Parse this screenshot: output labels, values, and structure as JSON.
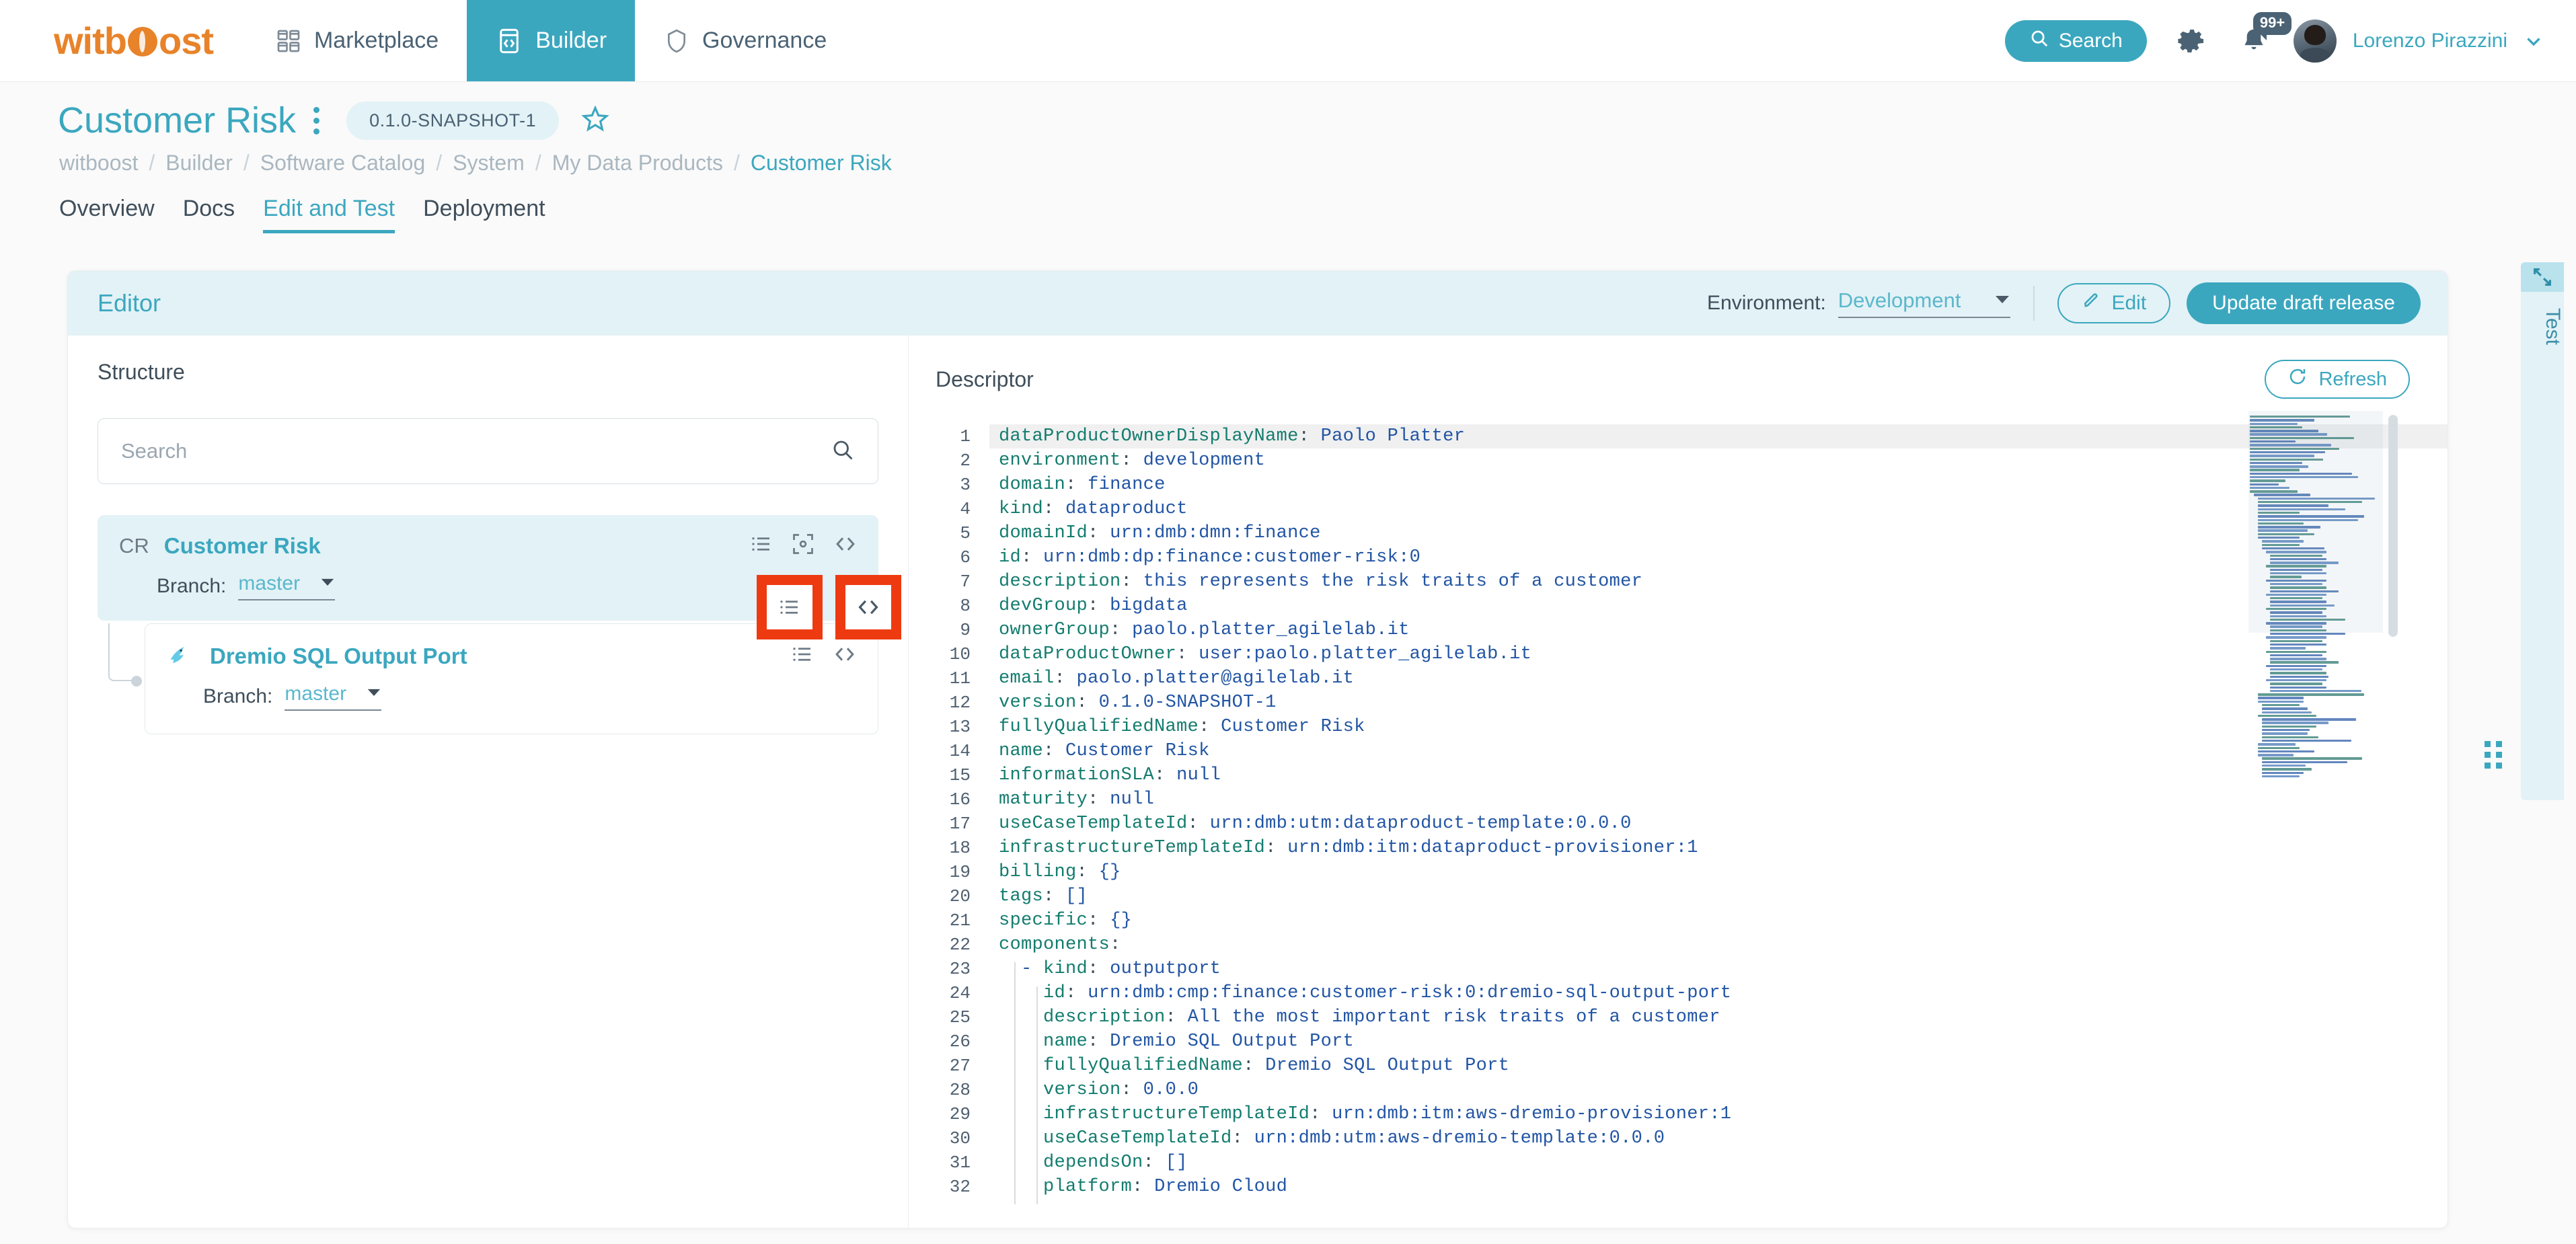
{
  "topnav": {
    "logo": "witboost",
    "items": [
      {
        "label": "Marketplace",
        "icon": "grid-icon",
        "active": false
      },
      {
        "label": "Builder",
        "icon": "code-window-icon",
        "active": true
      },
      {
        "label": "Governance",
        "icon": "shield-icon",
        "active": false
      }
    ],
    "search_label": "Search",
    "search_icon": "search-icon",
    "settings_icon": "gear-icon",
    "notifications_icon": "bell-icon",
    "notifications_badge": "99+",
    "user_name": "Lorenzo Pirazzini",
    "user_caret_icon": "chevron-down-icon",
    "avatar_icon": "avatar"
  },
  "page": {
    "title": "Customer Risk",
    "kebab_icon": "more-vertical-icon",
    "version_badge": "0.1.0-SNAPSHOT-1",
    "favorite_icon": "star-icon",
    "breadcrumb": [
      "witboost",
      "Builder",
      "Software Catalog",
      "System",
      "My Data Products",
      "Customer Risk"
    ],
    "tabs": [
      {
        "label": "Overview",
        "active": false
      },
      {
        "label": "Docs",
        "active": false
      },
      {
        "label": "Edit and Test",
        "active": true
      },
      {
        "label": "Deployment",
        "active": false
      }
    ]
  },
  "editor": {
    "title": "Editor",
    "environment_label": "Environment:",
    "environment_value": "Development",
    "environment_caret_icon": "caret-down-icon",
    "edit_button": "Edit",
    "edit_icon": "pencil-icon",
    "primary_button": "Update draft release"
  },
  "structure": {
    "title": "Structure",
    "search_placeholder": "Search",
    "search_value": "",
    "search_icon": "search-icon",
    "root": {
      "abbr": "CR",
      "name": "Customer Risk",
      "branch_label": "Branch:",
      "branch_value": "master",
      "actions": [
        "list-icon",
        "focus-target-icon",
        "code-brackets-icon"
      ]
    },
    "child": {
      "icon": "dremio-logo-icon",
      "name": "Dremio SQL Output Port",
      "branch_label": "Branch:",
      "branch_value": "master",
      "actions": [
        "list-icon",
        "code-brackets-icon"
      ],
      "highlighted_actions": [
        "list-icon",
        "code-brackets-icon"
      ]
    }
  },
  "descriptor": {
    "title": "Descriptor",
    "refresh_button": "Refresh",
    "refresh_icon": "refresh-icon",
    "lines": [
      {
        "n": 1,
        "indent": 0,
        "key": "dataProductOwnerDisplayName",
        "value": "Paolo Platter",
        "active": true
      },
      {
        "n": 2,
        "indent": 0,
        "key": "environment",
        "value": "development"
      },
      {
        "n": 3,
        "indent": 0,
        "key": "domain",
        "value": "finance"
      },
      {
        "n": 4,
        "indent": 0,
        "key": "kind",
        "value": "dataproduct"
      },
      {
        "n": 5,
        "indent": 0,
        "key": "domainId",
        "value": "urn:dmb:dmn:finance"
      },
      {
        "n": 6,
        "indent": 0,
        "key": "id",
        "value": "urn:dmb:dp:finance:customer-risk:0"
      },
      {
        "n": 7,
        "indent": 0,
        "key": "description",
        "value": "this represents the risk traits of a customer"
      },
      {
        "n": 8,
        "indent": 0,
        "key": "devGroup",
        "value": "bigdata"
      },
      {
        "n": 9,
        "indent": 0,
        "key": "ownerGroup",
        "value": "paolo.platter_agilelab.it"
      },
      {
        "n": 10,
        "indent": 0,
        "key": "dataProductOwner",
        "value": "user:paolo.platter_agilelab.it"
      },
      {
        "n": 11,
        "indent": 0,
        "key": "email",
        "value": "paolo.platter@agilelab.it"
      },
      {
        "n": 12,
        "indent": 0,
        "key": "version",
        "value": "0.1.0-SNAPSHOT-1"
      },
      {
        "n": 13,
        "indent": 0,
        "key": "fullyQualifiedName",
        "value": "Customer Risk"
      },
      {
        "n": 14,
        "indent": 0,
        "key": "name",
        "value": "Customer Risk"
      },
      {
        "n": 15,
        "indent": 0,
        "key": "informationSLA",
        "value": "null"
      },
      {
        "n": 16,
        "indent": 0,
        "key": "maturity",
        "value": "null"
      },
      {
        "n": 17,
        "indent": 0,
        "key": "useCaseTemplateId",
        "value": "urn:dmb:utm:dataproduct-template:0.0.0"
      },
      {
        "n": 18,
        "indent": 0,
        "key": "infrastructureTemplateId",
        "value": "urn:dmb:itm:dataproduct-provisioner:1"
      },
      {
        "n": 19,
        "indent": 0,
        "key": "billing",
        "value": "{}"
      },
      {
        "n": 20,
        "indent": 0,
        "key": "tags",
        "value": "[]"
      },
      {
        "n": 21,
        "indent": 0,
        "key": "specific",
        "value": "{}"
      },
      {
        "n": 22,
        "indent": 0,
        "key": "components",
        "value": ""
      },
      {
        "n": 23,
        "indent": 1,
        "dash": true,
        "key": "kind",
        "value": "outputport"
      },
      {
        "n": 24,
        "indent": 2,
        "key": "id",
        "value": "urn:dmb:cmp:finance:customer-risk:0:dremio-sql-output-port"
      },
      {
        "n": 25,
        "indent": 2,
        "key": "description",
        "value": "All the most important risk traits of a customer"
      },
      {
        "n": 26,
        "indent": 2,
        "key": "name",
        "value": "Dremio SQL Output Port"
      },
      {
        "n": 27,
        "indent": 2,
        "key": "fullyQualifiedName",
        "value": "Dremio SQL Output Port"
      },
      {
        "n": 28,
        "indent": 2,
        "key": "version",
        "value": "0.0.0"
      },
      {
        "n": 29,
        "indent": 2,
        "key": "infrastructureTemplateId",
        "value": "urn:dmb:itm:aws-dremio-provisioner:1"
      },
      {
        "n": 30,
        "indent": 2,
        "key": "useCaseTemplateId",
        "value": "urn:dmb:utm:aws-dremio-template:0.0.0"
      },
      {
        "n": 31,
        "indent": 2,
        "key": "dependsOn",
        "value": "[]"
      },
      {
        "n": 32,
        "indent": 2,
        "key": "platform",
        "value": "Dremio Cloud"
      }
    ],
    "minimap_indents": [
      0,
      0,
      0,
      0,
      0,
      0,
      0,
      0,
      0,
      0,
      0,
      0,
      0,
      0,
      0,
      0,
      0,
      0,
      0,
      0,
      0,
      0,
      1,
      2,
      2,
      2,
      2,
      2,
      2,
      2,
      2,
      2,
      2,
      2,
      2,
      3,
      3,
      3,
      4,
      5,
      5,
      5,
      4,
      5,
      5,
      5,
      4,
      5,
      5,
      5,
      4,
      5,
      5,
      5,
      4,
      5,
      5,
      5,
      4,
      5,
      5,
      5,
      4,
      5,
      5,
      5,
      4,
      5,
      5,
      5,
      4,
      5,
      5,
      5,
      4,
      5,
      5,
      5,
      2,
      2,
      2,
      3,
      3,
      3,
      2,
      3,
      3,
      3,
      3,
      3,
      3,
      3,
      2,
      2,
      2,
      2,
      3,
      3,
      3,
      3,
      3,
      3
    ],
    "minimap_widths": [
      96,
      62,
      46,
      50,
      66,
      74,
      100,
      44,
      78,
      86,
      72,
      62,
      70,
      50,
      56,
      48,
      98,
      104,
      34,
      28,
      38,
      46,
      54,
      112,
      100,
      68,
      84,
      40,
      102,
      96,
      44,
      60,
      48,
      54,
      40,
      40,
      36,
      60,
      58,
      50,
      54,
      66,
      58,
      50,
      54,
      30,
      58,
      50,
      54,
      66,
      58,
      50,
      54,
      62,
      58,
      50,
      54,
      72,
      58,
      50,
      54,
      72,
      58,
      50,
      54,
      34,
      58,
      50,
      54,
      66,
      58,
      50,
      54,
      56,
      58,
      50,
      54,
      88,
      102,
      44,
      44,
      36,
      44,
      48,
      56,
      90,
      64,
      52,
      46,
      44,
      54,
      86,
      36,
      40,
      54,
      34,
      96,
      82,
      42,
      48,
      40,
      36
    ]
  },
  "test_panel": {
    "label": "Test",
    "expand_icon": "expand-diagonal-icon",
    "drag_handle_icon": "drag-dots-icon"
  },
  "colors": {
    "accent": "#3BA7BF",
    "accent_light": "#E3F2F6",
    "brand_orange": "#E8832A",
    "annotation_red": "#EE3A11",
    "code_key": "#137C6E",
    "code_value": "#2255A4",
    "text_dark": "#3F4E5A",
    "text_muted": "#AAB7C0"
  }
}
